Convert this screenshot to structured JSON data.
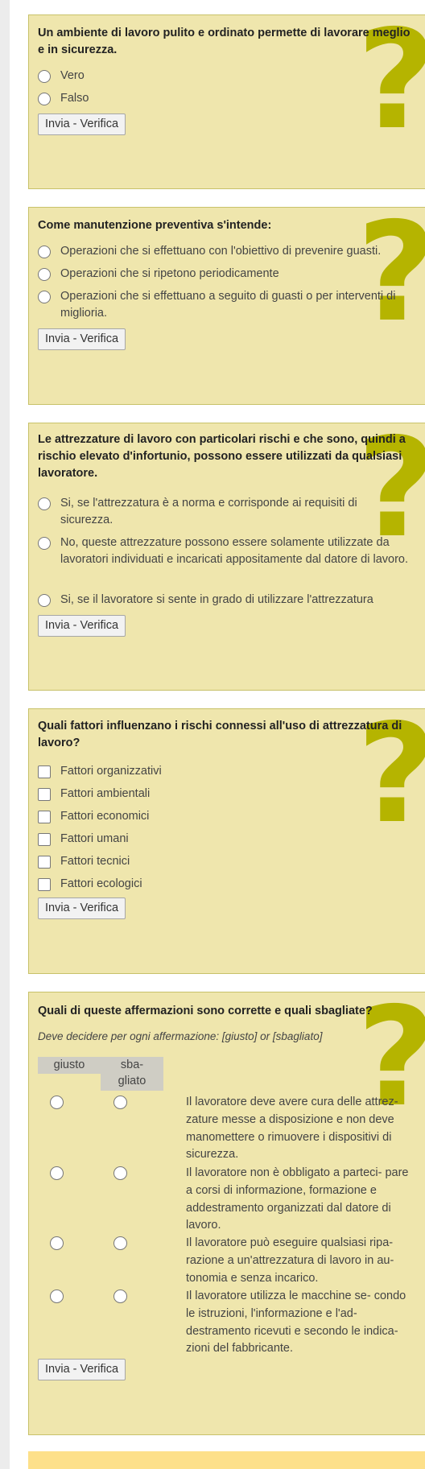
{
  "submit_label": "Invia - Verifica",
  "questions": [
    {
      "title": "Un ambiente di lavoro pulito e ordinato permette di lavorare meglio e in sicurezza.",
      "options": [
        "Vero",
        "Falso"
      ]
    },
    {
      "title": "Come manutenzione preventiva s'intende:",
      "options": [
        "Operazioni che si effettuano con l'obiettivo di prevenire guasti.",
        "Operazioni che si ripetono periodicamente",
        "Operazioni che si effettuano a seguito di guasti o per interventi di miglioria."
      ]
    },
    {
      "title": "Le attrezzature di lavoro con particolari rischi e che sono, quindi a rischio elevato d'infortunio, possono essere utilizzati da qualsiasi lavoratore.",
      "options": [
        "Si, se l'attrezzatura è a norma e corrisponde ai requisiti di sicurezza.",
        "No, queste attrezzature possono essere solamente utilizzate da lavoratori individuati e incaricati appositamente dal datore di lavoro.",
        "Si, se il lavoratore si sente in grado di utilizzare l'attrezzatura"
      ]
    },
    {
      "title": "Quali fattori influenzano i rischi connessi all'uso di attrezzatura di lavoro?",
      "options": [
        "Fattori organizzativi",
        "Fattori ambientali",
        "Fattori economici",
        "Fattori umani",
        "Fattori tecnici",
        "Fattori ecologici"
      ]
    },
    {
      "title": "Quali di queste affermazioni sono corrette e quali sbagliate?",
      "instruction": "Deve decidere per ogni affermazione: [giusto] or [sbagliato]",
      "col_right": "giusto",
      "col_wrong_1": "sba-",
      "col_wrong_2": "gliato",
      "statements": [
        "Il lavoratore deve avere cura delle attrez- zature messe a disposizione e non deve manomettere o rimuovere i dispositivi di sicurezza.",
        "Il lavoratore non è obbligato a parteci- pare a corsi di informazione, formazione e addestramento organizzati dal datore di lavoro.",
        "Il lavoratore può eseguire qualsiasi ripa- razione a un'attrezzatura di lavoro in au- tonomia e senza incarico.",
        "Il lavoratore utilizza le macchine se- condo le istruzioni, l'informazione e l'ad- destramento ricevuti e secondo le indica- zioni del fabbricante."
      ]
    }
  ]
}
